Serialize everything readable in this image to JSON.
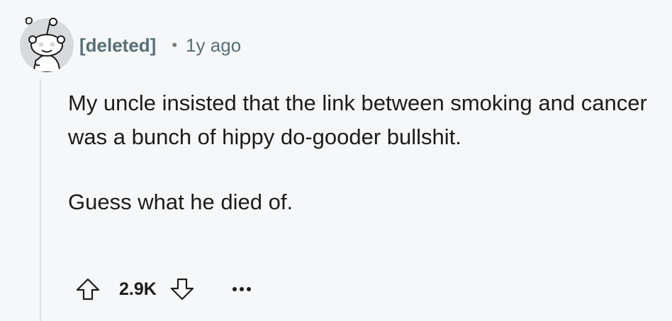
{
  "comment": {
    "author": "[deleted]",
    "separator": "•",
    "time": "1y ago",
    "paragraphs": [
      "My uncle insisted that the link between smoking and cancer was a bunch of hippy do-gooder bullshit.",
      "Guess what he died of."
    ],
    "score": "2.9K",
    "avatar_icon": "snoo-avatar-icon",
    "upvote_icon": "upvote-arrow-icon",
    "downvote_icon": "downvote-arrow-icon",
    "more_icon": "more-options-icon"
  },
  "colors": {
    "background": "#f6f7f8",
    "meta_text": "#576f76",
    "body_text": "#1c1c1c",
    "thread_line": "#dfe1e4"
  }
}
